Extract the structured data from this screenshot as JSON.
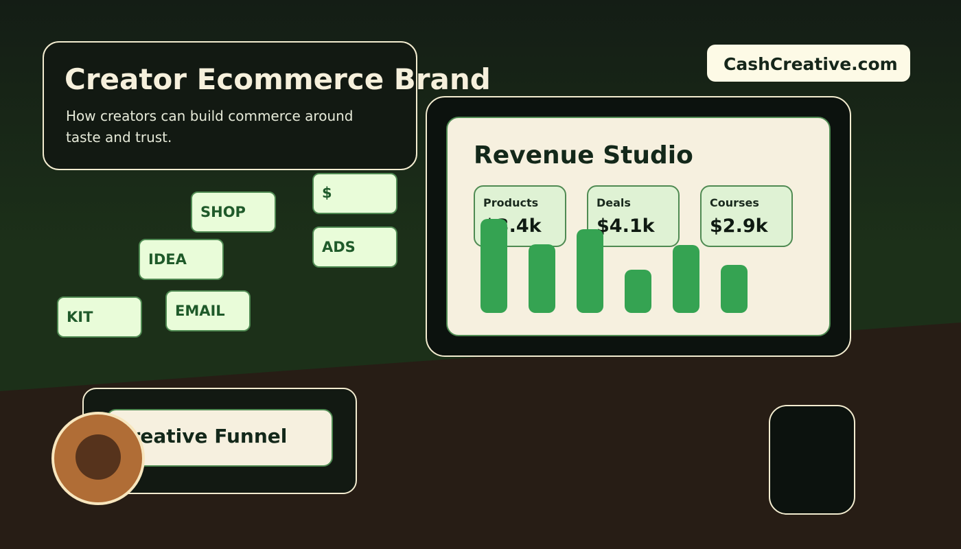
{
  "header": {
    "title": "Creator Ecommerce Brand",
    "subtitle": "How creators can build commerce around taste and trust."
  },
  "brand": {
    "site": "CashCreative.com"
  },
  "tags": [
    "SHOP",
    "$",
    "IDEA",
    "ADS",
    "KIT",
    "EMAIL"
  ],
  "dashboard": {
    "title": "Revenue Studio",
    "stats": [
      {
        "label": "Products",
        "value": "$3.4k"
      },
      {
        "label": "Deals",
        "value": "$4.1k"
      },
      {
        "label": "Courses",
        "value": "$2.9k"
      }
    ],
    "bars": [
      1.0,
      0.73,
      0.89,
      0.46,
      0.72,
      0.51
    ]
  },
  "funnel": {
    "label": "Creative Funnel"
  },
  "colors": {
    "accent_green": "#35a352",
    "cream": "#f6f0df",
    "tag_fill": "#e9fcd9",
    "donut_outer": "#b06d36",
    "donut_inner": "#56331c"
  }
}
